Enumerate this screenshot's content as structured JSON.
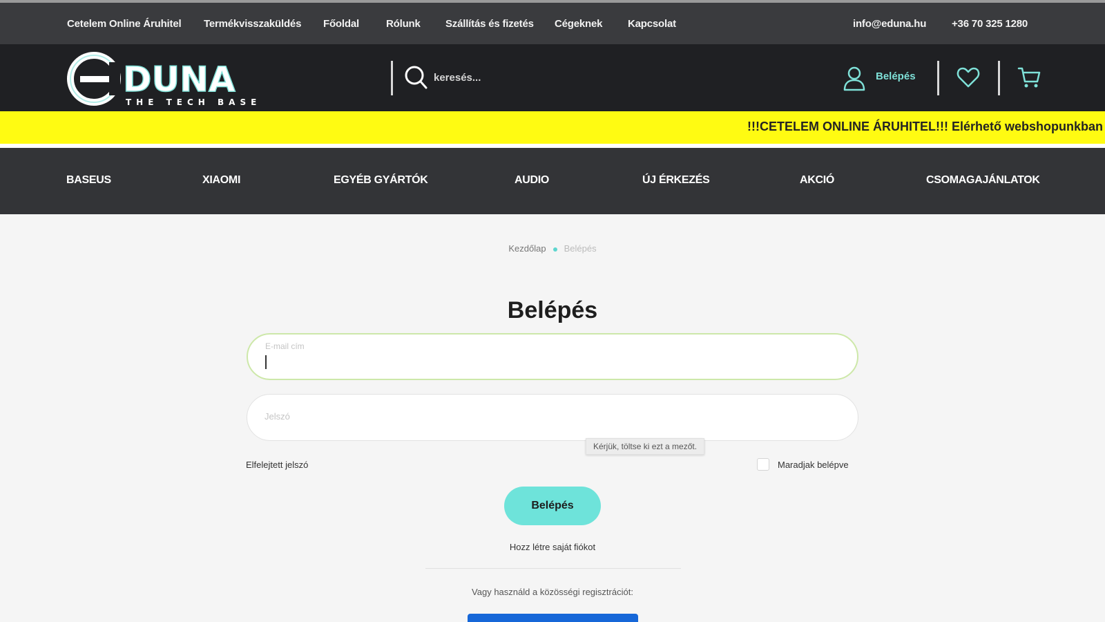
{
  "topbar": {
    "links": [
      "Cetelem Online Áruhitel",
      "Termékvisszaküldés",
      "Főoldal",
      "Rólunk",
      "Szállítás és fizetés",
      "Cégeknek",
      "Kapcsolat"
    ],
    "email": "info@eduna.hu",
    "phone": "+36 70 325 1280"
  },
  "header": {
    "logo_text": "DUNA",
    "logo_tagline": "THE TECH BASE",
    "search_placeholder": "keresés...",
    "login_label": "Belépés",
    "accent_color": "#7fe1d8"
  },
  "ticker": {
    "text": "!!!CETELEM ONLINE ÁRUHITEL!!! Elérhető webshopunkban",
    "background": "#fffb12"
  },
  "categories": [
    "BASEUS",
    "XIAOMI",
    "EGYÉB GYÁRTÓK",
    "AUDIO",
    "ÚJ ÉRKEZÉS",
    "AKCIÓ",
    "CSOMAGAJÁNLATOK"
  ],
  "breadcrumb": {
    "home": "Kezdőlap",
    "current": "Belépés"
  },
  "login_form": {
    "title": "Belépés",
    "email_label": "E-mail cím",
    "email_value": "",
    "password_label": "Jelszó",
    "password_value": "",
    "validation_tooltip": "Kérjük, töltse ki ezt a mezőt.",
    "forgot_password": "Elfelejtett jelszó",
    "remember_me": "Maradjak belépve",
    "remember_checked": false,
    "submit_label": "Belépés",
    "submit_color": "#6ee3da",
    "register_link": "Hozz létre saját fiókot",
    "social_text": "Vagy használd a közösségi regisztrációt:"
  }
}
